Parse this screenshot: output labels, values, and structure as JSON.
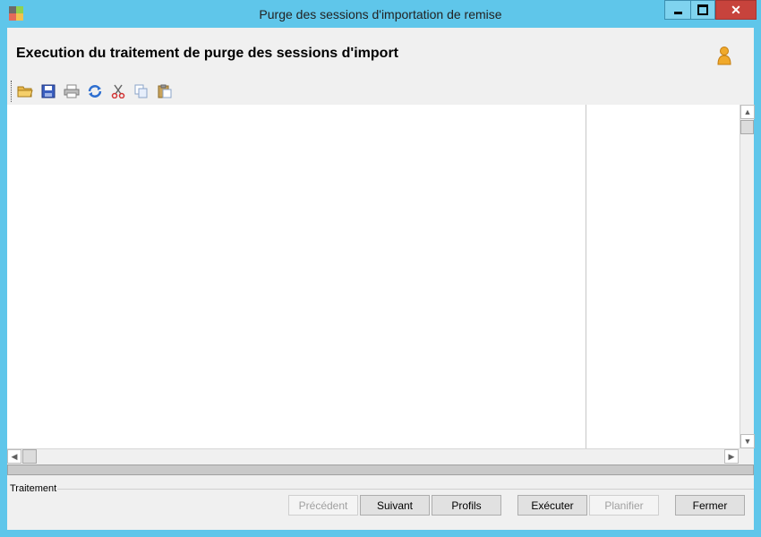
{
  "window": {
    "title": "Purge des sessions d'importation de remise",
    "buttons": {
      "minimize": "▬",
      "maximize": "□",
      "close": "✕"
    }
  },
  "header": {
    "title": "Execution du traitement de purge des sessions d'import",
    "user_icon": "user-icon"
  },
  "toolbar": {
    "icons": [
      "open-folder-icon",
      "save-icon",
      "print-icon",
      "refresh-icon",
      "cut-icon",
      "copy-icon",
      "paste-icon"
    ]
  },
  "scroll": {
    "up": "▲",
    "down": "▼",
    "left": "◀",
    "right": "▶"
  },
  "group": {
    "label": "Traitement"
  },
  "buttons": {
    "previous": "Précédent",
    "next": "Suivant",
    "profiles": "Profils",
    "execute": "Exécuter",
    "schedule": "Planifier",
    "close": "Fermer"
  },
  "colors": {
    "frame": "#5fc6ea",
    "close_button": "#c7433c",
    "client": "#f0f0f0"
  }
}
